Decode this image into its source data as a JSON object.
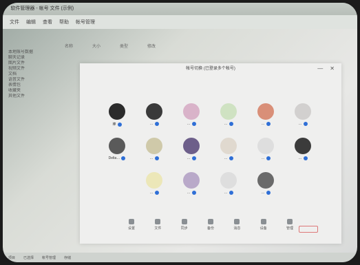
{
  "window": {
    "title": " 软件管理器 - 帐号 文件 (示例)",
    "menu": [
      "文件",
      "编辑",
      "查看",
      "帮助",
      "帐号管理"
    ]
  },
  "columns": [
    "名称",
    "大小",
    "类型",
    "修改"
  ],
  "sidebar": [
    "本地账号数据",
    "聊天记录",
    "图片文件",
    "视频文件",
    "文档",
    "语音文件",
    "表情包",
    "收藏夹",
    "其他文件"
  ],
  "dialog": {
    "title": "帐号切换 (已登录多个帐号)",
    "min": "—",
    "close": "✕"
  },
  "accounts": [
    {
      "name": "棒",
      "style": "#2b2b2b",
      "badge": true
    },
    {
      "name": "…",
      "style": "#3a3a3a",
      "badge": true
    },
    {
      "name": "…",
      "style": "#d9b3c9",
      "badge": true
    },
    {
      "name": "…",
      "style": "#cfe2c2",
      "badge": true
    },
    {
      "name": "…",
      "style": "#d98f78",
      "badge": true
    },
    {
      "name": "…",
      "style": "#d2d0cf",
      "badge": true
    },
    {
      "name": "Delta…",
      "style": "#5a5a5a",
      "badge": true
    },
    {
      "name": "…",
      "style": "#cfc9a9",
      "badge": true
    },
    {
      "name": "…",
      "style": "#6d5f8a",
      "badge": true
    },
    {
      "name": "…",
      "style": "#e0d9cf",
      "badge": true
    },
    {
      "name": "…",
      "style": "#dedede",
      "badge": true
    },
    {
      "name": "…",
      "style": "#3b3b3b",
      "badge": true
    },
    {
      "name": "…",
      "style": "#ece7b8",
      "badge": true
    },
    {
      "name": "…",
      "style": "#b9a9c9",
      "badge": true
    },
    {
      "name": "…",
      "style": "#dedede",
      "badge": true
    },
    {
      "name": "…",
      "style": "#6a6a6a",
      "badge": true
    }
  ],
  "footer": [
    "设置",
    "文件",
    "同步",
    "备份",
    "消息",
    "设备",
    "管理"
  ],
  "status": [
    "项目",
    "已选择",
    "帐号管理",
    "存储"
  ]
}
